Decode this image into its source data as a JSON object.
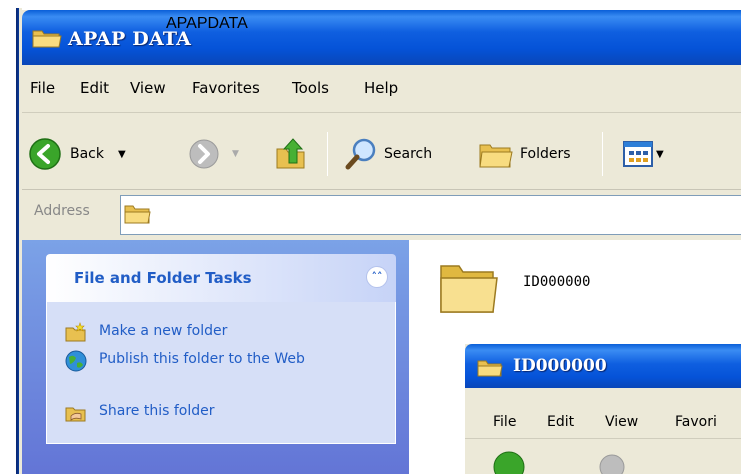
{
  "main_window": {
    "title": "APAP DATA",
    "menu": [
      "File",
      "Edit",
      "View",
      "Favorites",
      "Tools",
      "Help"
    ],
    "toolbar": {
      "back_label": "Back",
      "search_label": "Search",
      "folders_label": "Folders"
    },
    "address": {
      "label": "Address",
      "value": "APAPDATA"
    },
    "tasks": {
      "title": "File and Folder Tasks",
      "collapse_glyph": "˄˄",
      "items": [
        "Make a new folder",
        "Publish this folder to the Web",
        "Share this folder"
      ]
    },
    "content": {
      "folders": [
        "ID000000"
      ]
    }
  },
  "sub_window": {
    "title": "ID000000",
    "menu": [
      "File",
      "Edit",
      "View",
      "Favori"
    ]
  },
  "colors": {
    "titlebar": "#0553d8",
    "task_link": "#215dc6",
    "pane_bg": "#7ba2e7",
    "window_bg": "#ece9d8"
  }
}
